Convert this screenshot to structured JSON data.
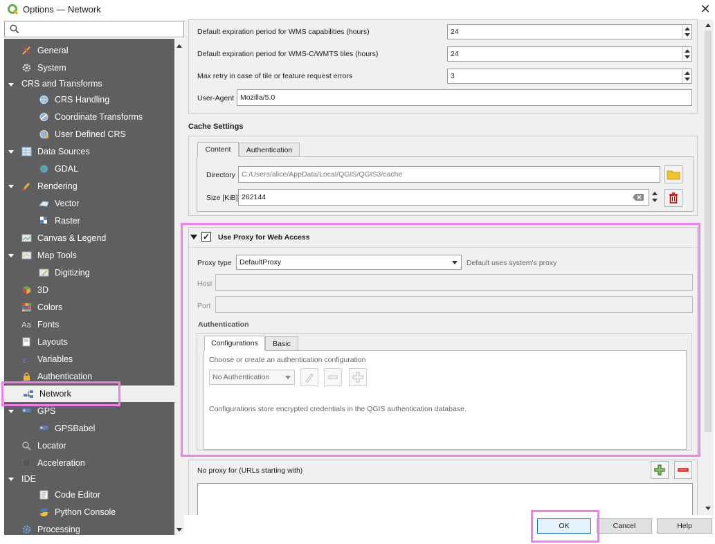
{
  "window": {
    "title": "Options — Network",
    "close_symbol": "✕"
  },
  "search": {
    "placeholder": ""
  },
  "sidebar": {
    "items": [
      {
        "label": "General",
        "icon": "tools-icon"
      },
      {
        "label": "System",
        "icon": "gear-icon"
      },
      {
        "label": "CRS and Transforms",
        "icon": "",
        "expandable": true
      },
      {
        "label": "CRS Handling",
        "icon": "globe-icon"
      },
      {
        "label": "Coordinate Transforms",
        "icon": "globe-transform-icon"
      },
      {
        "label": "User Defined CRS",
        "icon": "globe-user-icon"
      },
      {
        "label": "Data Sources",
        "icon": "table-icon",
        "expandable": true
      },
      {
        "label": "GDAL",
        "icon": "gdal-globe-icon"
      },
      {
        "label": "Rendering",
        "icon": "brush-icon",
        "expandable": true
      },
      {
        "label": "Vector",
        "icon": "vector-icon"
      },
      {
        "label": "Raster",
        "icon": "raster-icon"
      },
      {
        "label": "Canvas & Legend",
        "icon": "canvas-icon"
      },
      {
        "label": "Map Tools",
        "icon": "map-tools-icon",
        "expandable": true
      },
      {
        "label": "Digitizing",
        "icon": "digitizing-icon"
      },
      {
        "label": "3D",
        "icon": "cube-icon"
      },
      {
        "label": "Colors",
        "icon": "palette-icon"
      },
      {
        "label": "Fonts",
        "icon": "font-icon"
      },
      {
        "label": "Layouts",
        "icon": "layout-icon"
      },
      {
        "label": "Variables",
        "icon": "variables-icon"
      },
      {
        "label": "Authentication",
        "icon": "lock-icon"
      },
      {
        "label": "Network",
        "icon": "network-icon",
        "selected": true
      },
      {
        "label": "GPS",
        "icon": "gps-icon",
        "expandable": true
      },
      {
        "label": "GPSBabel",
        "icon": "gpsbabel-icon"
      },
      {
        "label": "Locator",
        "icon": "magnifier-icon"
      },
      {
        "label": "Acceleration",
        "icon": "chip-icon"
      },
      {
        "label": "IDE",
        "icon": "",
        "expandable": true
      },
      {
        "label": "Code Editor",
        "icon": "code-icon"
      },
      {
        "label": "Python Console",
        "icon": "python-icon"
      },
      {
        "label": "Processing",
        "icon": "processing-gear-icon"
      }
    ]
  },
  "network": {
    "wms_capabilities": {
      "label": "Default expiration period for WMS capabilities (hours)",
      "value": "24"
    },
    "wmts_tiles": {
      "label": "Default expiration period for WMS-C/WMTS tiles (hours)",
      "value": "24"
    },
    "max_retry": {
      "label": "Max retry in case of tile or feature request errors",
      "value": "3"
    },
    "user_agent": {
      "label": "User-Agent",
      "value": "Mozilla/5.0"
    }
  },
  "cache": {
    "title": "Cache Settings",
    "tabs": [
      "Content",
      "Authentication"
    ],
    "directory": {
      "label": "Directory",
      "value": "C:/Users/alice/AppData/Local/QGIS/QGIS3/cache"
    },
    "size": {
      "label": "Size [KiB]",
      "value": "262144"
    }
  },
  "proxy": {
    "title": "Use Proxy for Web Access",
    "checked_symbol": "✓",
    "type_label": "Proxy type",
    "type_value": "DefaultProxy",
    "type_hint": "Default uses system's proxy",
    "host_label": "Host",
    "port_label": "Port",
    "auth_title": "Authentication",
    "auth_tabs": [
      "Configurations",
      "Basic"
    ],
    "auth_prompt": "Choose or create an authentication configuration",
    "auth_combo": "No Authentication",
    "auth_note": "Configurations store encrypted credentials in the QGIS authentication database."
  },
  "no_proxy": {
    "label": "No proxy for (URLs starting with)"
  },
  "buttons": {
    "ok": "OK",
    "cancel": "Cancel",
    "help": "Help"
  },
  "colors": {
    "sidebar_bg": "#5f5f5f",
    "highlight": "#f57cf0",
    "accent": "#0078d7"
  }
}
